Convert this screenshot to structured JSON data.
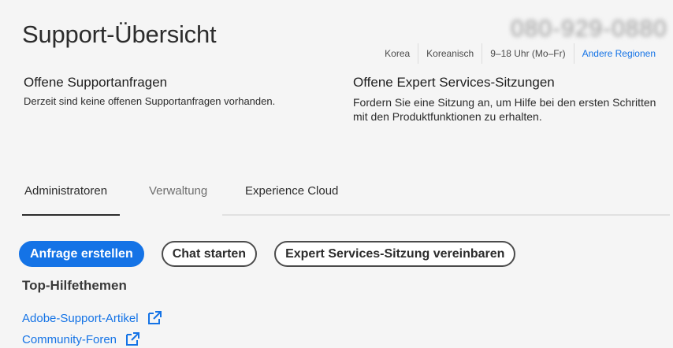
{
  "header": {
    "title": "Support-Übersicht",
    "phone": "080-929-0880"
  },
  "region": {
    "country": "Korea",
    "language": "Koreanisch",
    "hours": "9–18 Uhr (Mo–Fr)",
    "other_regions": "Andere Regionen"
  },
  "open_requests": {
    "heading": "Offene Supportanfragen",
    "text": "Derzeit sind keine offenen Supportanfragen vorhanden."
  },
  "open_sessions": {
    "heading": "Offene Expert Services-Sitzungen",
    "text": "Fordern Sie eine Sitzung an, um Hilfe bei den ersten Schritten mit den Produktfunktionen zu erhalten."
  },
  "tabs": [
    {
      "label": "Administratoren",
      "active": true
    },
    {
      "label": "Verwaltung",
      "active": false
    },
    {
      "label": "Experience Cloud",
      "active": false
    }
  ],
  "actions": {
    "create_request": "Anfrage erstellen",
    "start_chat": "Chat starten",
    "schedule_session": "Expert Services-Sitzung vereinbaren"
  },
  "help": {
    "title": "Top-Hilfethemen",
    "links": [
      {
        "label": "Adobe-Support-Artikel",
        "icon": "external-link-icon"
      },
      {
        "label": "Community-Foren",
        "icon": "external-link-icon"
      }
    ]
  },
  "colors": {
    "accent": "#1473e6",
    "text": "#2c2c2c",
    "background": "#f5f5f5"
  }
}
